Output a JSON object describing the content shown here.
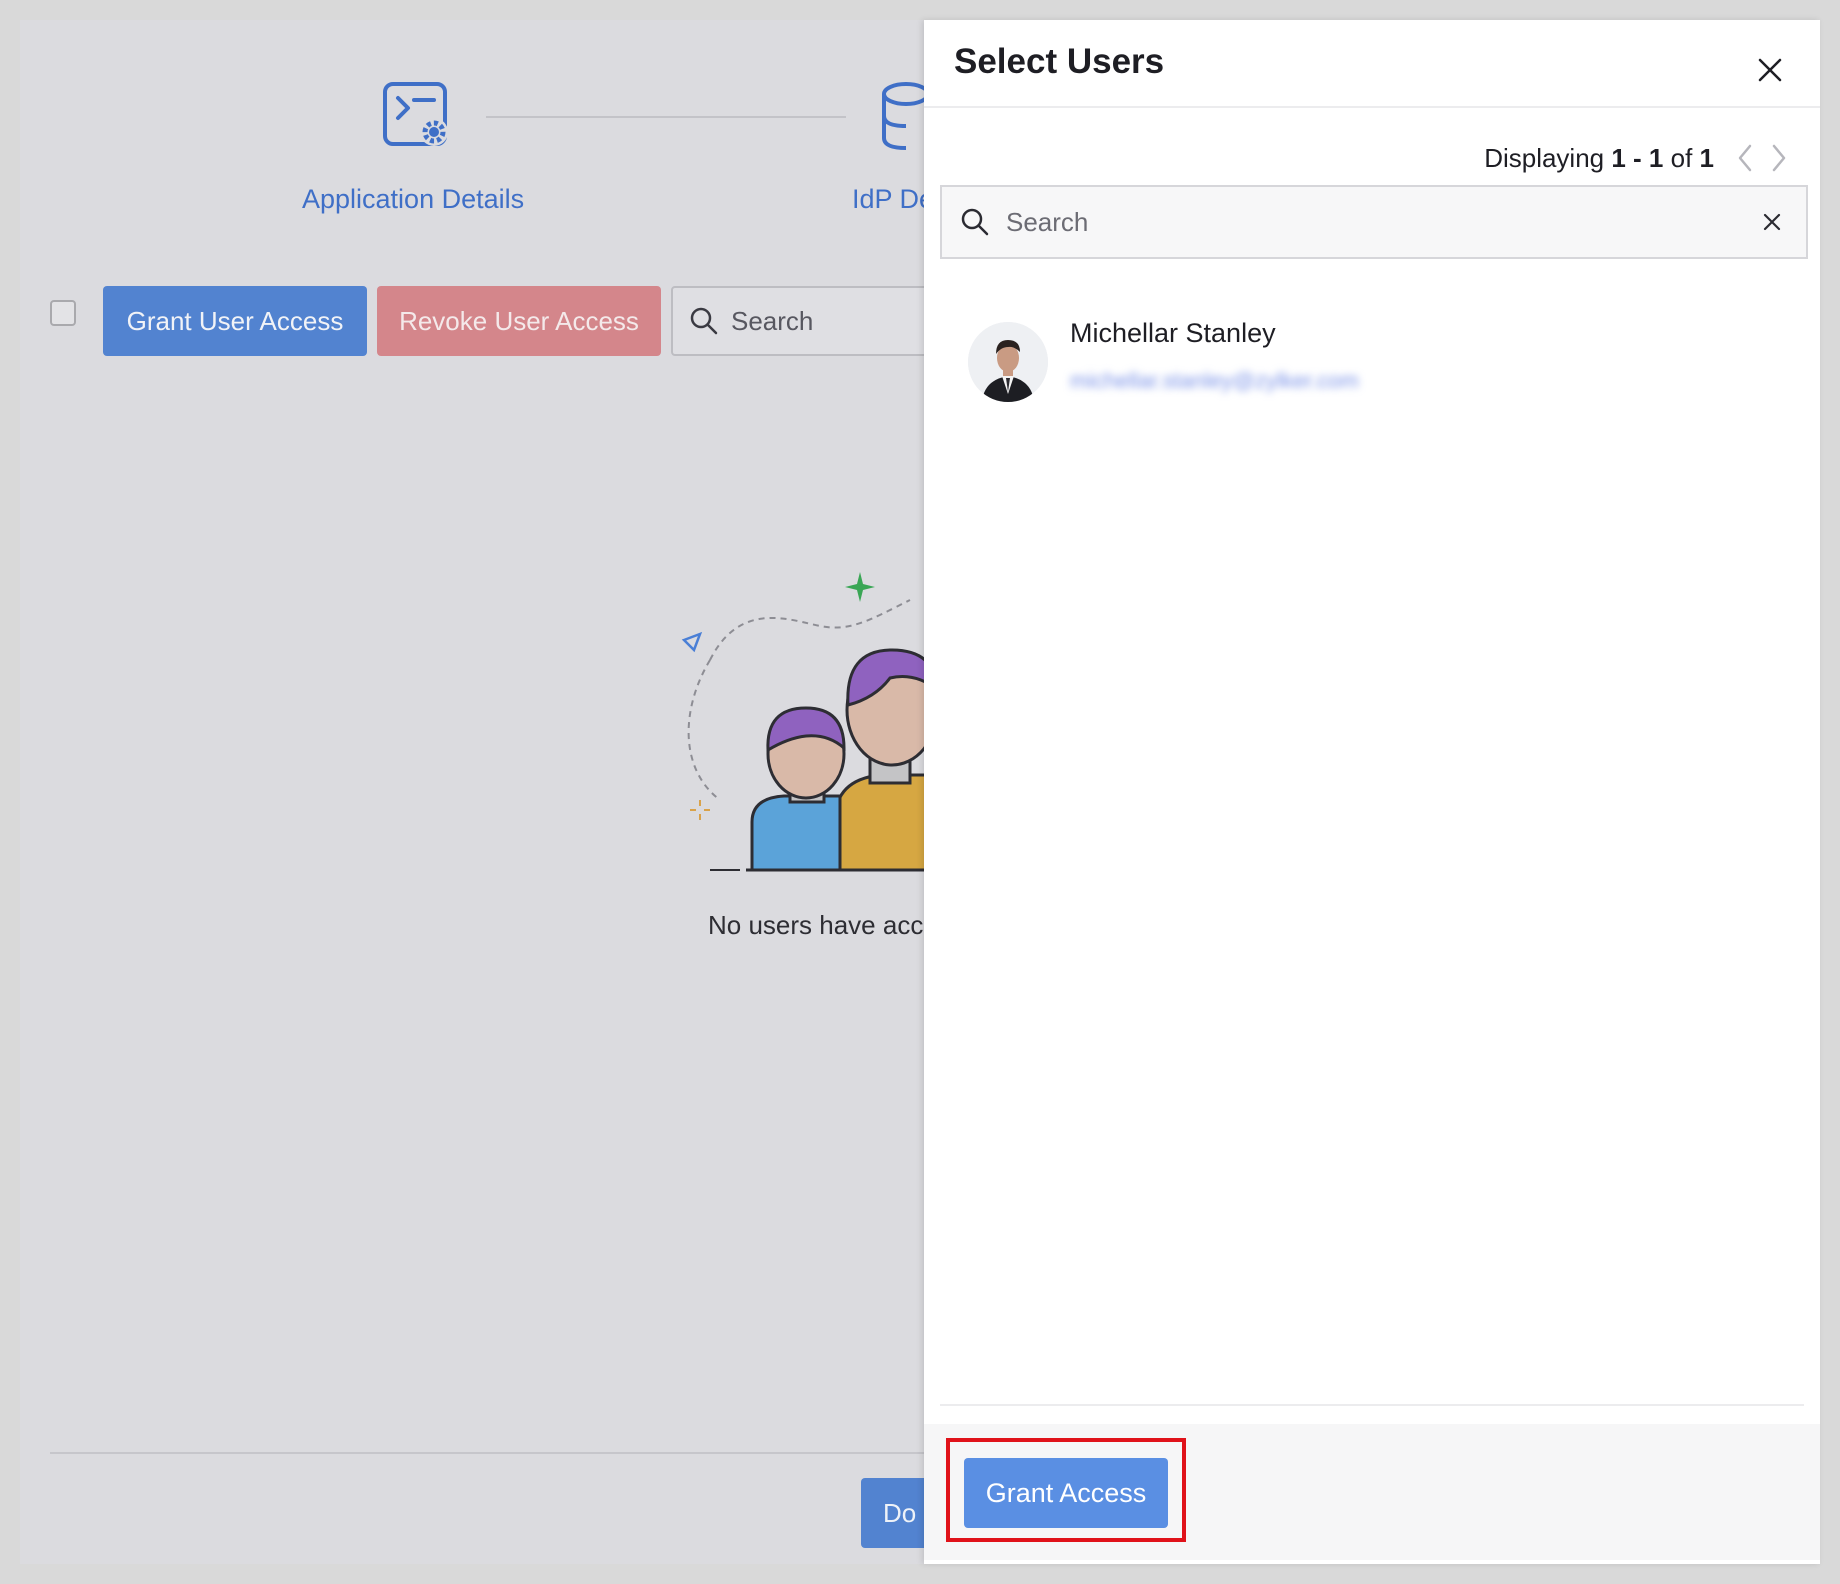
{
  "background": {
    "steps": [
      {
        "label": "Application Details",
        "icon": "app-config-icon"
      },
      {
        "label": "IdP De",
        "icon": "database-config-icon"
      }
    ],
    "toolbar": {
      "grant_label": "Grant User Access",
      "revoke_label": "Revoke User Access",
      "search_placeholder": "Search"
    },
    "empty_state_text": "No users have acc",
    "done_label": "Do"
  },
  "panel": {
    "title": "Select Users",
    "pager": {
      "prefix": "Displaying ",
      "range": "1 - 1",
      "of": " of ",
      "total": "1"
    },
    "search_placeholder": "Search",
    "users": [
      {
        "name": "Michellar Stanley",
        "email": "michellar.stanley@zylker.com"
      }
    ],
    "grant_label": "Grant Access"
  },
  "colors": {
    "primary": "#5a8fe3",
    "danger": "#d4868b",
    "highlight": "#e0121a",
    "link": "#3f6fc7"
  }
}
